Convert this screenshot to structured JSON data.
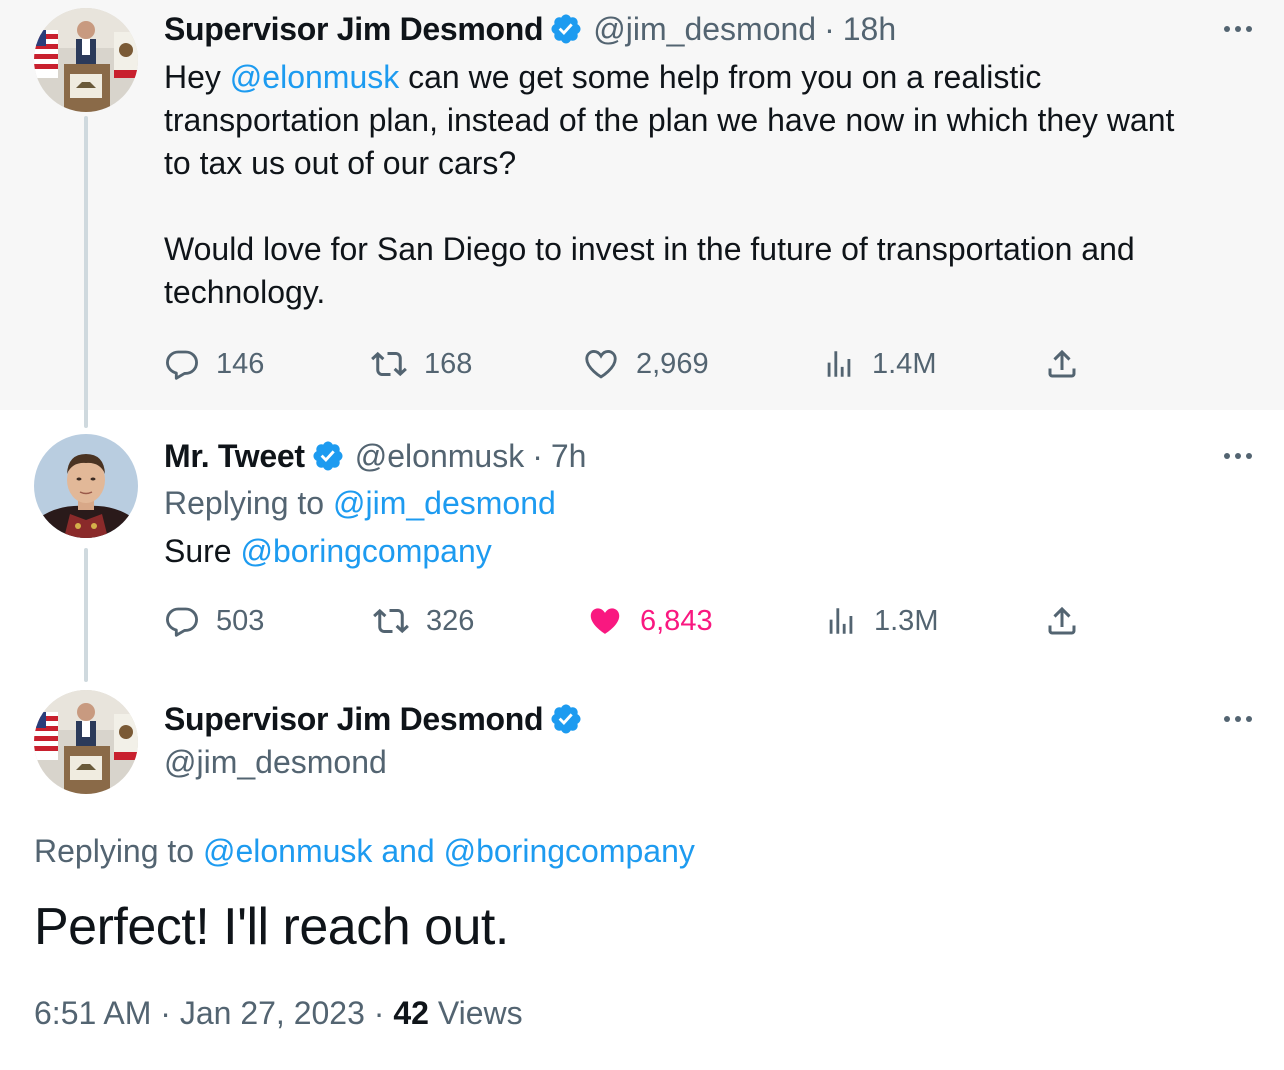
{
  "colors": {
    "link": "#1d9bf0",
    "like": "#f91880",
    "muted": "#536471",
    "text": "#0f1419",
    "verified": "#1d9bf0"
  },
  "tweet1": {
    "author": "Supervisor Jim Desmond",
    "handle": "@jim_desmond",
    "time": "18h",
    "text_hey": "Hey",
    "mention": "@elonmusk",
    "line1_rest": "can we get some help from you on a realistic",
    "line2": "transportation plan, instead of the plan we have now in which they want",
    "line3": "to tax us out of our cars?",
    "line4": "Would love for San Diego to invest in the future of transportation and",
    "line5": "technology.",
    "stats": {
      "replies": "146",
      "retweets": "168",
      "likes": "2,969",
      "views": "1.4M"
    }
  },
  "tweet2": {
    "author": "Mr. Tweet",
    "handle": "@elonmusk",
    "time": "7h",
    "replying_label": "Replying to",
    "replying_to": "@jim_desmond",
    "text": "Sure",
    "mention": "@boringcompany",
    "stats": {
      "replies": "503",
      "retweets": "326",
      "likes": "6,843",
      "views": "1.3M"
    }
  },
  "tweet3": {
    "author": "Supervisor Jim Desmond",
    "handle": "@jim_desmond",
    "replying_label": "Replying to",
    "replying_to": "@elonmusk and @boringcompany",
    "text": "Perfect! I'll reach out.",
    "time": "6:51 AM",
    "date": "Jan 27, 2023",
    "views_count": "42",
    "views_label": "Views"
  },
  "icons": [
    "reply-icon",
    "retweet-icon",
    "like-icon",
    "views-icon",
    "share-icon",
    "verified-badge-icon",
    "more-icon"
  ]
}
